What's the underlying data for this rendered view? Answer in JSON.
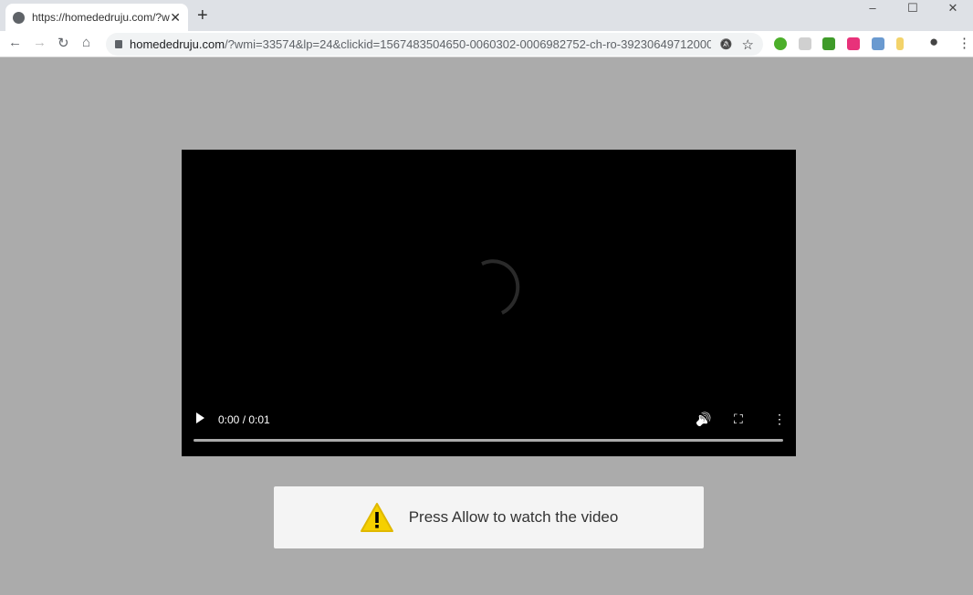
{
  "tab": {
    "title": "https://homededruju.com/?wmi=",
    "close": "✕",
    "new_tab": "+"
  },
  "window": {
    "minimize": "–",
    "maximize": "☐",
    "close": "✕"
  },
  "nav": {
    "back": "←",
    "forward": "→",
    "reload": "↻",
    "home": "⌂"
  },
  "omnibox": {
    "host": "homededruju.com",
    "path": "/?wmi=33574&lp=24&clickid=1567483504650-0060302-0006982752-ch-ro-39230649712000690825...",
    "mute": "🔕",
    "star": "☆"
  },
  "extensions": [
    {
      "name": "green-circle",
      "color": "#4caf2a"
    },
    {
      "name": "robot",
      "color": "#d0d0d0"
    },
    {
      "name": "green-box",
      "color": "#3f9b2a"
    },
    {
      "name": "pink-box",
      "color": "#e8327a"
    },
    {
      "name": "blue-box",
      "color": "#6a9ad0"
    },
    {
      "name": "key",
      "color": "#f3d36a"
    }
  ],
  "profile": "●",
  "menu": "⋮",
  "video": {
    "time": "0:00 / 0:01",
    "progress": 0,
    "volume": "🔊",
    "fullscreen": "⛶",
    "more": "⋮"
  },
  "notice": {
    "text": "Press Allow to watch the video",
    "icon": "warning-icon",
    "icon_color": "#f5d000"
  }
}
